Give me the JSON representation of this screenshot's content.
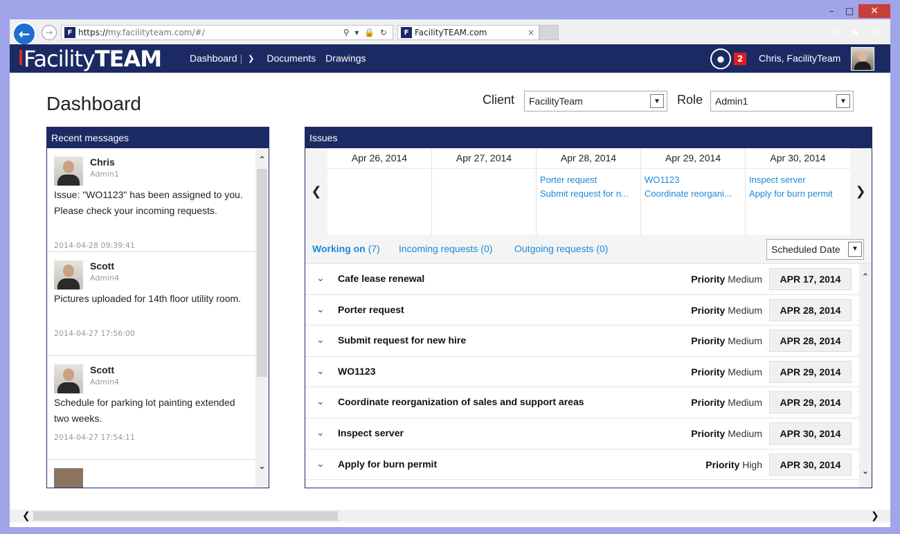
{
  "window": {
    "minimize": "–",
    "maximize": "□",
    "close": "✕"
  },
  "browser": {
    "back_icon": "arrow-left-icon",
    "forward_icon": "arrow-right-icon",
    "url_scheme": "https://",
    "url_rest": "my.facilityteam.com/#/",
    "favicon_letter": "F",
    "address_icons": "⚲ ▾ 🔒 ↻",
    "tab_title": "FacilityTEAM.com",
    "tab_close": "×",
    "right_icons": "⌂ ★ ⚙"
  },
  "header": {
    "logo_light": "Facility",
    "logo_bold": "TEAM",
    "nav": {
      "dashboard": "Dashboard",
      "documents": "Documents",
      "drawings": "Drawings"
    },
    "notification_count": "2",
    "user_name": "Chris, FacilityTeam"
  },
  "page": {
    "title": "Dashboard",
    "client_label": "Client",
    "client_value": "FacilityTeam",
    "role_label": "Role",
    "role_value": "Admin1"
  },
  "messages": {
    "heading": "Recent messages",
    "items": [
      {
        "name": "Chris",
        "role": "Admin1",
        "text": "Issue: \"WO1123\" has been assigned to you. Please check your incoming requests.",
        "time": "2014-04-28 09:39:41"
      },
      {
        "name": "Scott",
        "role": "Admin4",
        "text": "Pictures uploaded for 14th floor utility room.",
        "time": "2014-04-27 17:56:00"
      },
      {
        "name": "Scott",
        "role": "Admin4",
        "text": "Schedule for parking lot painting extended two weeks.",
        "time": "2014-04-27 17:54:11"
      }
    ]
  },
  "issues": {
    "heading": "Issues",
    "calendar": [
      {
        "date": "Apr 26, 2014",
        "links": []
      },
      {
        "date": "Apr 27, 2014",
        "links": []
      },
      {
        "date": "Apr 28, 2014",
        "links": [
          "Porter request",
          "Submit request for n..."
        ]
      },
      {
        "date": "Apr 29, 2014",
        "links": [
          "WO1123",
          "Coordinate reorgani..."
        ]
      },
      {
        "date": "Apr 30, 2014",
        "links": [
          "Inspect server",
          "Apply for burn permit"
        ]
      }
    ],
    "tabs": {
      "working_label": "Working on",
      "working_count": "(7)",
      "incoming": "Incoming requests (0)",
      "outgoing": "Outgoing requests (0)"
    },
    "sort": "Scheduled Date",
    "priority_label": "Priority",
    "rows": [
      {
        "title": "Cafe lease renewal",
        "priority": "Medium",
        "date": "APR 17, 2014"
      },
      {
        "title": "Porter request",
        "priority": "Medium",
        "date": "APR 28, 2014"
      },
      {
        "title": "Submit request for new hire",
        "priority": "Medium",
        "date": "APR 28, 2014"
      },
      {
        "title": "WO1123",
        "priority": "Medium",
        "date": "APR 29, 2014"
      },
      {
        "title": "Coordinate reorganization of sales and support areas",
        "priority": "Medium",
        "date": "APR 29, 2014"
      },
      {
        "title": "Inspect server",
        "priority": "Medium",
        "date": "APR 30, 2014"
      },
      {
        "title": "Apply for burn permit",
        "priority": "High",
        "date": "APR 30, 2014"
      }
    ]
  }
}
